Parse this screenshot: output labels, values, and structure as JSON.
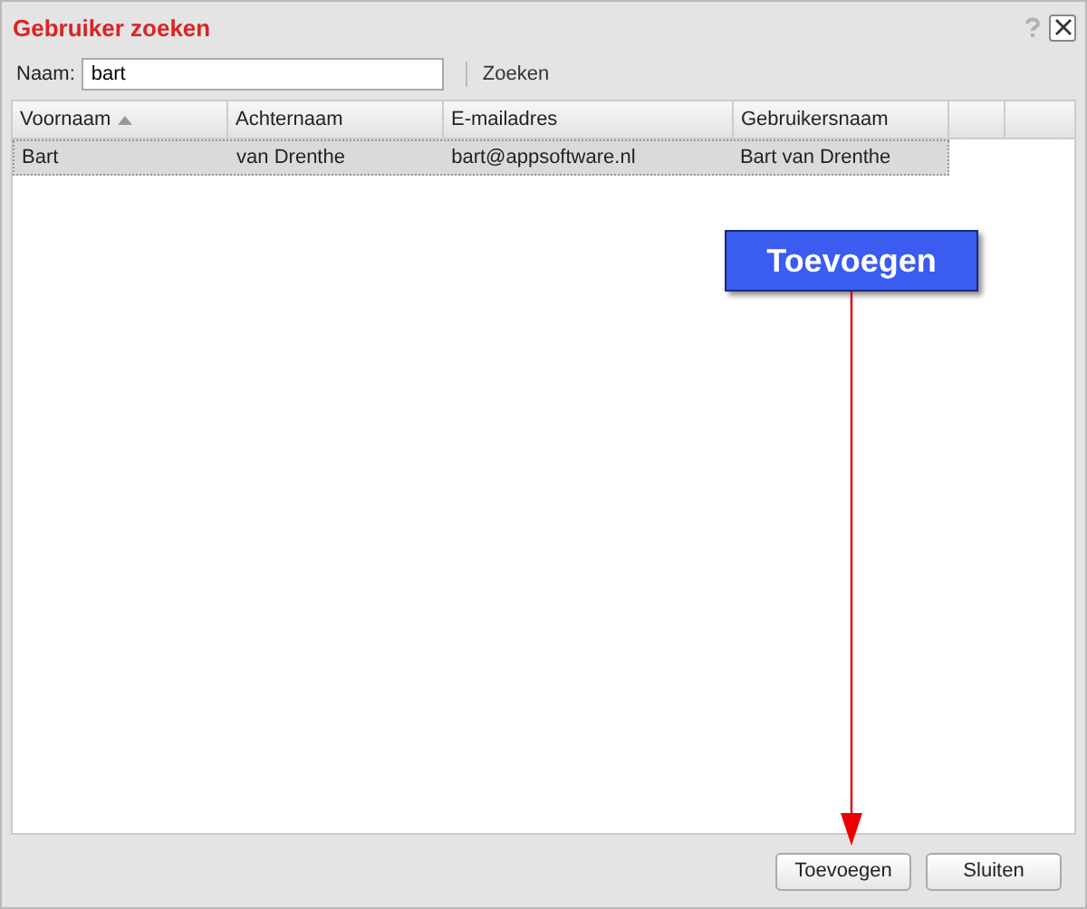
{
  "window": {
    "title": "Gebruiker zoeken"
  },
  "search": {
    "label": "Naam:",
    "value": "bart",
    "button": "Zoeken"
  },
  "table": {
    "columns": [
      {
        "label": "Voornaam",
        "sorted": true
      },
      {
        "label": "Achternaam",
        "sorted": false
      },
      {
        "label": "E-mailadres",
        "sorted": false
      },
      {
        "label": "Gebruikersnaam",
        "sorted": false
      }
    ],
    "rows": [
      {
        "cells": [
          "Bart",
          "van Drenthe",
          "bart@appsoftware.nl",
          "Bart van Drenthe"
        ],
        "selected": true
      }
    ]
  },
  "callout": {
    "text": "Toevoegen"
  },
  "buttons": [
    "Toevoegen",
    "Sluiten"
  ]
}
